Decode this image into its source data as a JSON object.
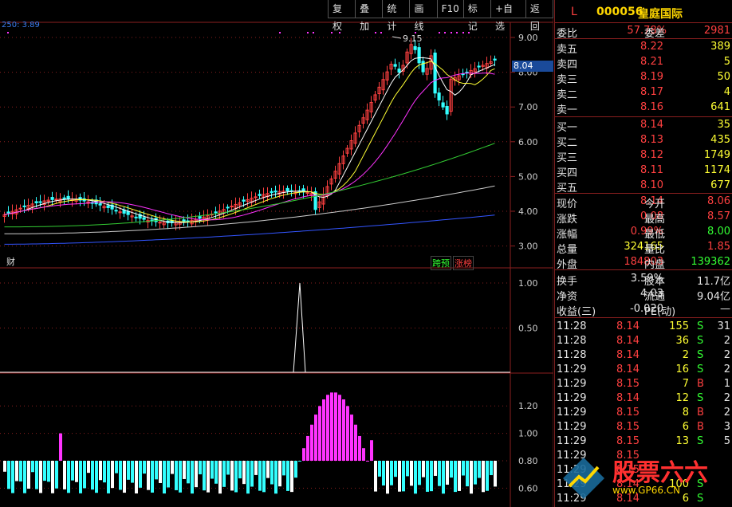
{
  "toolbar": [
    "复权",
    "叠加",
    "统计",
    "画线",
    "F10",
    "标记",
    "+自选",
    "返回"
  ],
  "indicator_label": "250: 3.89",
  "price_marker": "8.04",
  "high_annotation": "9.15",
  "price_axis": [
    "9.00",
    "8.00",
    "7.00",
    "6.00",
    "5.00",
    "4.00",
    "3.00"
  ],
  "pane2_axis": [
    "1.00",
    "0.50"
  ],
  "pane3_axis": [
    "1.20",
    "1.00",
    "0.80",
    "0.60"
  ],
  "tags": {
    "cai": "财",
    "yuyan": "跨预",
    "zhangbang": "涨榜"
  },
  "header": {
    "mode": "L",
    "code": "000056",
    "name": "皇庭国际"
  },
  "weibi": {
    "label1": "委比",
    "value1": "57.78%",
    "label2": "委差",
    "value2": "2981"
  },
  "sell": [
    {
      "label": "卖五",
      "price": "8.22",
      "vol": "389"
    },
    {
      "label": "卖四",
      "price": "8.21",
      "vol": "5"
    },
    {
      "label": "卖三",
      "price": "8.19",
      "vol": "50"
    },
    {
      "label": "卖二",
      "price": "8.17",
      "vol": "4"
    },
    {
      "label": "卖一",
      "price": "8.16",
      "vol": "641"
    }
  ],
  "buy": [
    {
      "label": "买一",
      "price": "8.14",
      "vol": "35"
    },
    {
      "label": "买二",
      "price": "8.13",
      "vol": "435"
    },
    {
      "label": "买三",
      "price": "8.12",
      "vol": "1749"
    },
    {
      "label": "买四",
      "price": "8.11",
      "vol": "1174"
    },
    {
      "label": "买五",
      "price": "8.10",
      "vol": "677"
    }
  ],
  "quote": [
    {
      "l1": "现价",
      "v1": "8.14",
      "l2": "今开",
      "v2": "8.06"
    },
    {
      "l1": "涨跌",
      "v1": "0.08",
      "l2": "最高",
      "v2": "8.57"
    },
    {
      "l1": "涨幅",
      "v1": "0.99%",
      "l2": "最低",
      "v2": "8.00"
    },
    {
      "l1": "总量",
      "v1": "324165",
      "l2": "量比",
      "v2": "1.85"
    },
    {
      "l1": "外盘",
      "v1": "184803",
      "l2": "内盘",
      "v2": "139362"
    }
  ],
  "fundamentals": [
    {
      "l1": "换手",
      "v1": "3.59%",
      "l2": "股本",
      "v2": "11.7亿"
    },
    {
      "l1": "净资",
      "v1": "4.03",
      "l2": "流通",
      "v2": "9.04亿"
    },
    {
      "l1": "收益(三)",
      "v1": "-0.020",
      "l2": "PE(动)",
      "v2": "—"
    }
  ],
  "ticks": [
    {
      "time": "11:28",
      "price": "8.14",
      "vol": "155",
      "side": "S",
      "n": "31"
    },
    {
      "time": "11:28",
      "price": "8.14",
      "vol": "36",
      "side": "S",
      "n": "2"
    },
    {
      "time": "11:28",
      "price": "8.14",
      "vol": "2",
      "side": "S",
      "n": "2"
    },
    {
      "time": "11:29",
      "price": "8.14",
      "vol": "16",
      "side": "S",
      "n": "2"
    },
    {
      "time": "11:29",
      "price": "8.15",
      "vol": "7",
      "side": "B",
      "n": "1"
    },
    {
      "time": "11:29",
      "price": "8.14",
      "vol": "12",
      "side": "S",
      "n": "2"
    },
    {
      "time": "11:29",
      "price": "8.15",
      "vol": "8",
      "side": "B",
      "n": "2"
    },
    {
      "time": "11:29",
      "price": "8.15",
      "vol": "6",
      "side": "B",
      "n": "3"
    },
    {
      "time": "11:29",
      "price": "8.15",
      "vol": "13",
      "side": "S",
      "n": "5"
    },
    {
      "time": "11:29",
      "price": "8.15",
      "vol": "",
      "side": "",
      "n": ""
    },
    {
      "time": "11:29",
      "price": "8.15",
      "vol": "",
      "side": "",
      "n": ""
    },
    {
      "time": "11:29",
      "price": "8.14",
      "vol": "100",
      "side": "S",
      "n": ""
    },
    {
      "time": "11:29",
      "price": "8.14",
      "vol": "6",
      "side": "S",
      "n": ""
    }
  ],
  "watermark": {
    "text": "股票六六",
    "url": "www.GP66.CN",
    "icon": "chart-logo-icon"
  },
  "colors": {
    "up": "#ff4040",
    "down": "#33ffff",
    "accent": "#ffd700",
    "grid": "#8b1f1f"
  }
}
